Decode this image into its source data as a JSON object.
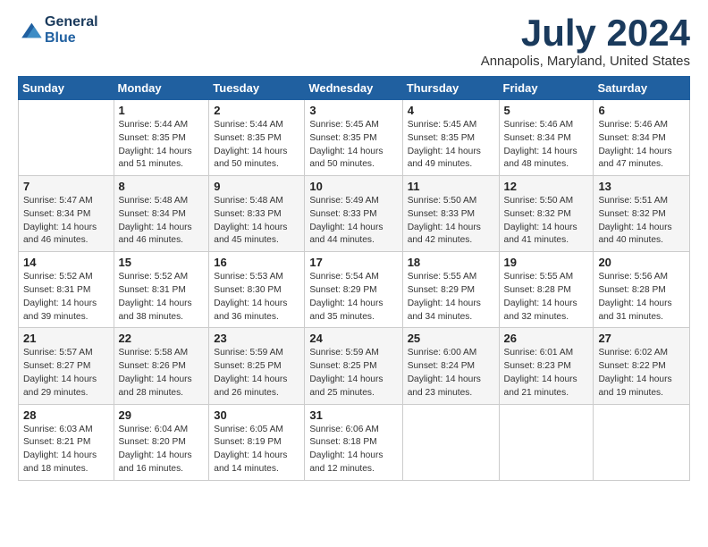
{
  "logo": {
    "line1": "General",
    "line2": "Blue"
  },
  "title": "July 2024",
  "location": "Annapolis, Maryland, United States",
  "days_header": [
    "Sunday",
    "Monday",
    "Tuesday",
    "Wednesday",
    "Thursday",
    "Friday",
    "Saturday"
  ],
  "weeks": [
    [
      {
        "num": "",
        "info": ""
      },
      {
        "num": "1",
        "info": "Sunrise: 5:44 AM\nSunset: 8:35 PM\nDaylight: 14 hours\nand 51 minutes."
      },
      {
        "num": "2",
        "info": "Sunrise: 5:44 AM\nSunset: 8:35 PM\nDaylight: 14 hours\nand 50 minutes."
      },
      {
        "num": "3",
        "info": "Sunrise: 5:45 AM\nSunset: 8:35 PM\nDaylight: 14 hours\nand 50 minutes."
      },
      {
        "num": "4",
        "info": "Sunrise: 5:45 AM\nSunset: 8:35 PM\nDaylight: 14 hours\nand 49 minutes."
      },
      {
        "num": "5",
        "info": "Sunrise: 5:46 AM\nSunset: 8:34 PM\nDaylight: 14 hours\nand 48 minutes."
      },
      {
        "num": "6",
        "info": "Sunrise: 5:46 AM\nSunset: 8:34 PM\nDaylight: 14 hours\nand 47 minutes."
      }
    ],
    [
      {
        "num": "7",
        "info": "Sunrise: 5:47 AM\nSunset: 8:34 PM\nDaylight: 14 hours\nand 46 minutes."
      },
      {
        "num": "8",
        "info": "Sunrise: 5:48 AM\nSunset: 8:34 PM\nDaylight: 14 hours\nand 46 minutes."
      },
      {
        "num": "9",
        "info": "Sunrise: 5:48 AM\nSunset: 8:33 PM\nDaylight: 14 hours\nand 45 minutes."
      },
      {
        "num": "10",
        "info": "Sunrise: 5:49 AM\nSunset: 8:33 PM\nDaylight: 14 hours\nand 44 minutes."
      },
      {
        "num": "11",
        "info": "Sunrise: 5:50 AM\nSunset: 8:33 PM\nDaylight: 14 hours\nand 42 minutes."
      },
      {
        "num": "12",
        "info": "Sunrise: 5:50 AM\nSunset: 8:32 PM\nDaylight: 14 hours\nand 41 minutes."
      },
      {
        "num": "13",
        "info": "Sunrise: 5:51 AM\nSunset: 8:32 PM\nDaylight: 14 hours\nand 40 minutes."
      }
    ],
    [
      {
        "num": "14",
        "info": "Sunrise: 5:52 AM\nSunset: 8:31 PM\nDaylight: 14 hours\nand 39 minutes."
      },
      {
        "num": "15",
        "info": "Sunrise: 5:52 AM\nSunset: 8:31 PM\nDaylight: 14 hours\nand 38 minutes."
      },
      {
        "num": "16",
        "info": "Sunrise: 5:53 AM\nSunset: 8:30 PM\nDaylight: 14 hours\nand 36 minutes."
      },
      {
        "num": "17",
        "info": "Sunrise: 5:54 AM\nSunset: 8:29 PM\nDaylight: 14 hours\nand 35 minutes."
      },
      {
        "num": "18",
        "info": "Sunrise: 5:55 AM\nSunset: 8:29 PM\nDaylight: 14 hours\nand 34 minutes."
      },
      {
        "num": "19",
        "info": "Sunrise: 5:55 AM\nSunset: 8:28 PM\nDaylight: 14 hours\nand 32 minutes."
      },
      {
        "num": "20",
        "info": "Sunrise: 5:56 AM\nSunset: 8:28 PM\nDaylight: 14 hours\nand 31 minutes."
      }
    ],
    [
      {
        "num": "21",
        "info": "Sunrise: 5:57 AM\nSunset: 8:27 PM\nDaylight: 14 hours\nand 29 minutes."
      },
      {
        "num": "22",
        "info": "Sunrise: 5:58 AM\nSunset: 8:26 PM\nDaylight: 14 hours\nand 28 minutes."
      },
      {
        "num": "23",
        "info": "Sunrise: 5:59 AM\nSunset: 8:25 PM\nDaylight: 14 hours\nand 26 minutes."
      },
      {
        "num": "24",
        "info": "Sunrise: 5:59 AM\nSunset: 8:25 PM\nDaylight: 14 hours\nand 25 minutes."
      },
      {
        "num": "25",
        "info": "Sunrise: 6:00 AM\nSunset: 8:24 PM\nDaylight: 14 hours\nand 23 minutes."
      },
      {
        "num": "26",
        "info": "Sunrise: 6:01 AM\nSunset: 8:23 PM\nDaylight: 14 hours\nand 21 minutes."
      },
      {
        "num": "27",
        "info": "Sunrise: 6:02 AM\nSunset: 8:22 PM\nDaylight: 14 hours\nand 19 minutes."
      }
    ],
    [
      {
        "num": "28",
        "info": "Sunrise: 6:03 AM\nSunset: 8:21 PM\nDaylight: 14 hours\nand 18 minutes."
      },
      {
        "num": "29",
        "info": "Sunrise: 6:04 AM\nSunset: 8:20 PM\nDaylight: 14 hours\nand 16 minutes."
      },
      {
        "num": "30",
        "info": "Sunrise: 6:05 AM\nSunset: 8:19 PM\nDaylight: 14 hours\nand 14 minutes."
      },
      {
        "num": "31",
        "info": "Sunrise: 6:06 AM\nSunset: 8:18 PM\nDaylight: 14 hours\nand 12 minutes."
      },
      {
        "num": "",
        "info": ""
      },
      {
        "num": "",
        "info": ""
      },
      {
        "num": "",
        "info": ""
      }
    ]
  ]
}
